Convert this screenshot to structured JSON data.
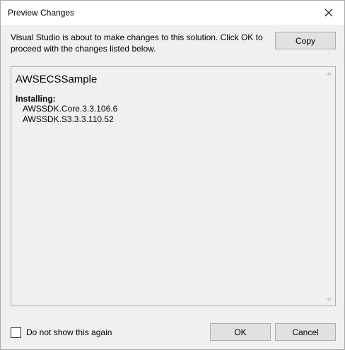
{
  "window": {
    "title": "Preview Changes",
    "close_icon": "close-icon"
  },
  "message": "Visual Studio is about to make changes to this solution. Click OK to proceed with the changes listed below.",
  "buttons": {
    "copy": "Copy",
    "ok": "OK",
    "cancel": "Cancel"
  },
  "preview": {
    "project": "AWSECSSample",
    "section_label": "Installing:",
    "packages": [
      "AWSSDK.Core.3.3.106.6",
      "AWSSDK.S3.3.3.110.52"
    ]
  },
  "checkbox": {
    "label": "Do not show this again",
    "checked": false
  },
  "colors": {
    "dialog_bg": "#f0f0f0",
    "titlebar_bg": "#ffffff",
    "button_bg": "#e1e1e1",
    "button_border": "#adadad"
  }
}
